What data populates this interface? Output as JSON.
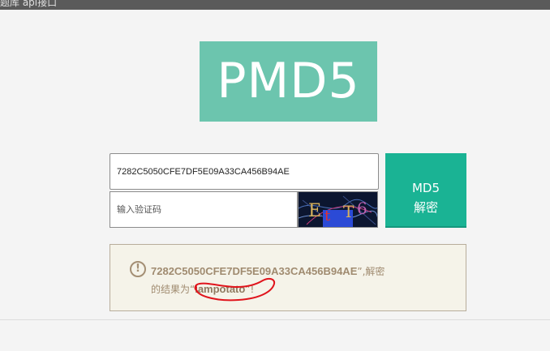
{
  "window": {
    "title_fragment": "题库  api接口"
  },
  "logo": {
    "text": "PMD5",
    "color": "#6cc5ae"
  },
  "form": {
    "hash_value": "7282C5050CFE7DF5E09A33CA456B94AE",
    "captcha_placeholder": "输入验证码",
    "captcha_glyphs": [
      "E",
      "t",
      "T",
      "6"
    ],
    "button_line1": "MD5",
    "button_line2": "解密",
    "button_color": "#1ab394"
  },
  "result": {
    "icon": "exclamation-circle-icon",
    "hash": "7282C5050CFE7DF5E09A33CA456B94AE",
    "mid_text": "”,解密",
    "line2_prefix": "的结果为“",
    "plaintext": "iampotato",
    "suffix": "”!",
    "annotation_color": "#e0141c"
  }
}
